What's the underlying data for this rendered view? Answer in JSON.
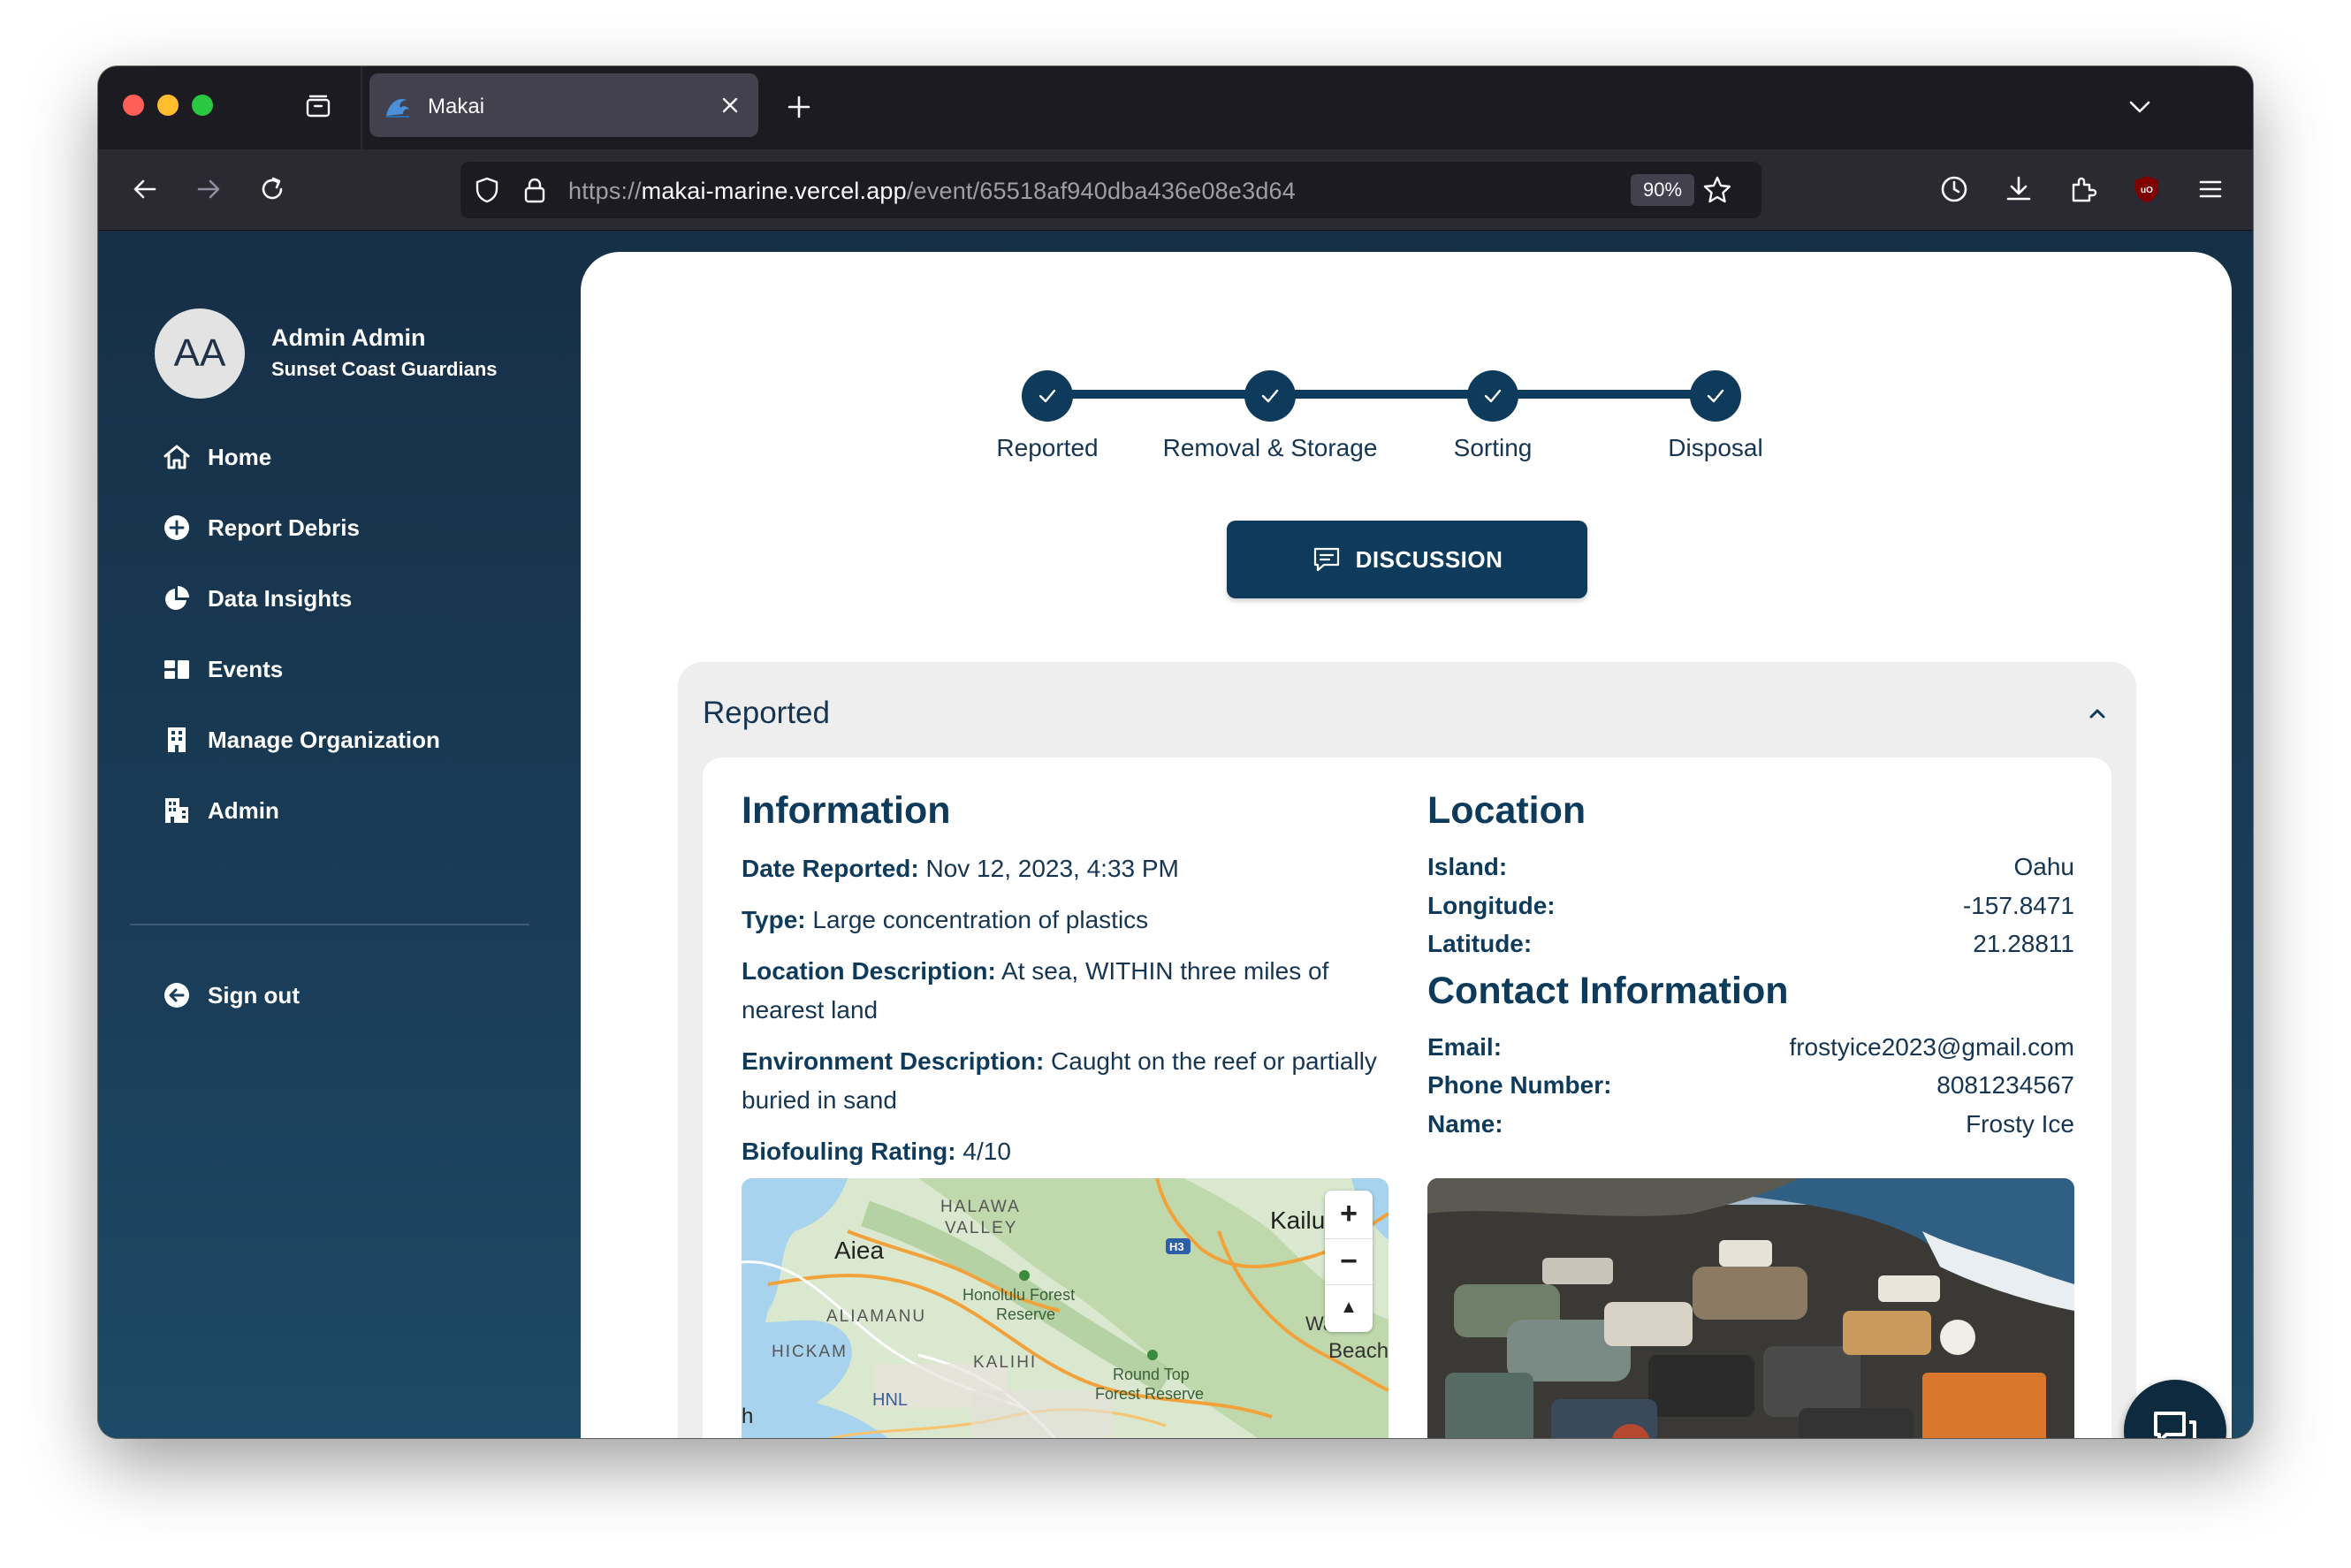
{
  "browser": {
    "tab_title": "Makai",
    "url_scheme": "https://",
    "url_host": "makai-marine.vercel.app",
    "url_path": "/event/65518af940dba436e08e3d64",
    "zoom": "90%"
  },
  "sidebar": {
    "avatar_initials": "AA",
    "user_name": "Admin Admin",
    "organization": "Sunset Coast Guardians",
    "items": [
      {
        "label": "Home",
        "icon": "home-icon"
      },
      {
        "label": "Report Debris",
        "icon": "plus-circle-icon"
      },
      {
        "label": "Data Insights",
        "icon": "pie-chart-icon"
      },
      {
        "label": "Events",
        "icon": "events-icon"
      },
      {
        "label": "Manage Organization",
        "icon": "building-icon"
      },
      {
        "label": "Admin",
        "icon": "admin-building-icon"
      }
    ],
    "sign_out": "Sign out"
  },
  "stepper": {
    "steps": [
      {
        "label": "Reported",
        "complete": true
      },
      {
        "label": "Removal & Storage",
        "complete": true
      },
      {
        "label": "Sorting",
        "complete": true
      },
      {
        "label": "Disposal",
        "complete": true
      }
    ]
  },
  "discussion_button": "DISCUSSION",
  "accordion": {
    "title": "Reported",
    "expanded": true
  },
  "information": {
    "heading": "Information",
    "date_label": "Date Reported:",
    "date_value": "Nov 12, 2023, 4:33 PM",
    "type_label": "Type:",
    "type_value": "Large concentration of plastics",
    "location_desc_label": "Location Description:",
    "location_desc_value": "At sea, WITHIN three miles of nearest land",
    "environment_label": "Environment Description:",
    "environment_value": "Caught on the reef or partially buried in sand",
    "biofouling_label": "Biofouling Rating:",
    "biofouling_value": "4/10"
  },
  "location": {
    "heading": "Location",
    "island_label": "Island:",
    "island_value": "Oahu",
    "longitude_label": "Longitude:",
    "longitude_value": "-157.8471",
    "latitude_label": "Latitude:",
    "latitude_value": "21.28811"
  },
  "contact": {
    "heading": "Contact Information",
    "email_label": "Email:",
    "email_value": "frostyice2023@gmail.com",
    "phone_label": "Phone Number:",
    "phone_value": "8081234567",
    "name_label": "Name:",
    "name_value": "Frosty Ice"
  },
  "map": {
    "labels": {
      "aiea": "Aiea",
      "halawa": "HALAWA",
      "valley": "VALLEY",
      "honolulu_forest_1": "Honolulu Forest",
      "honolulu_forest_2": "Reserve",
      "aliamanu": "ALIAMANU",
      "hickam": "HICKAM",
      "kalihi": "KALIHI",
      "hnl": "HNL",
      "round_top_1": "Round Top",
      "round_top_2": "Forest Reserve",
      "kailua": "Kailu",
      "waimanalo": "Wa",
      "beach": "Beach",
      "h3": "H3",
      "edge_h": "h"
    },
    "zoom_in": "+",
    "zoom_out": "−",
    "compass": "▲"
  },
  "colors": {
    "primary": "#0e3b5c",
    "sidebar_bg": "#162f47",
    "accordion_bg": "#eeeeee"
  }
}
